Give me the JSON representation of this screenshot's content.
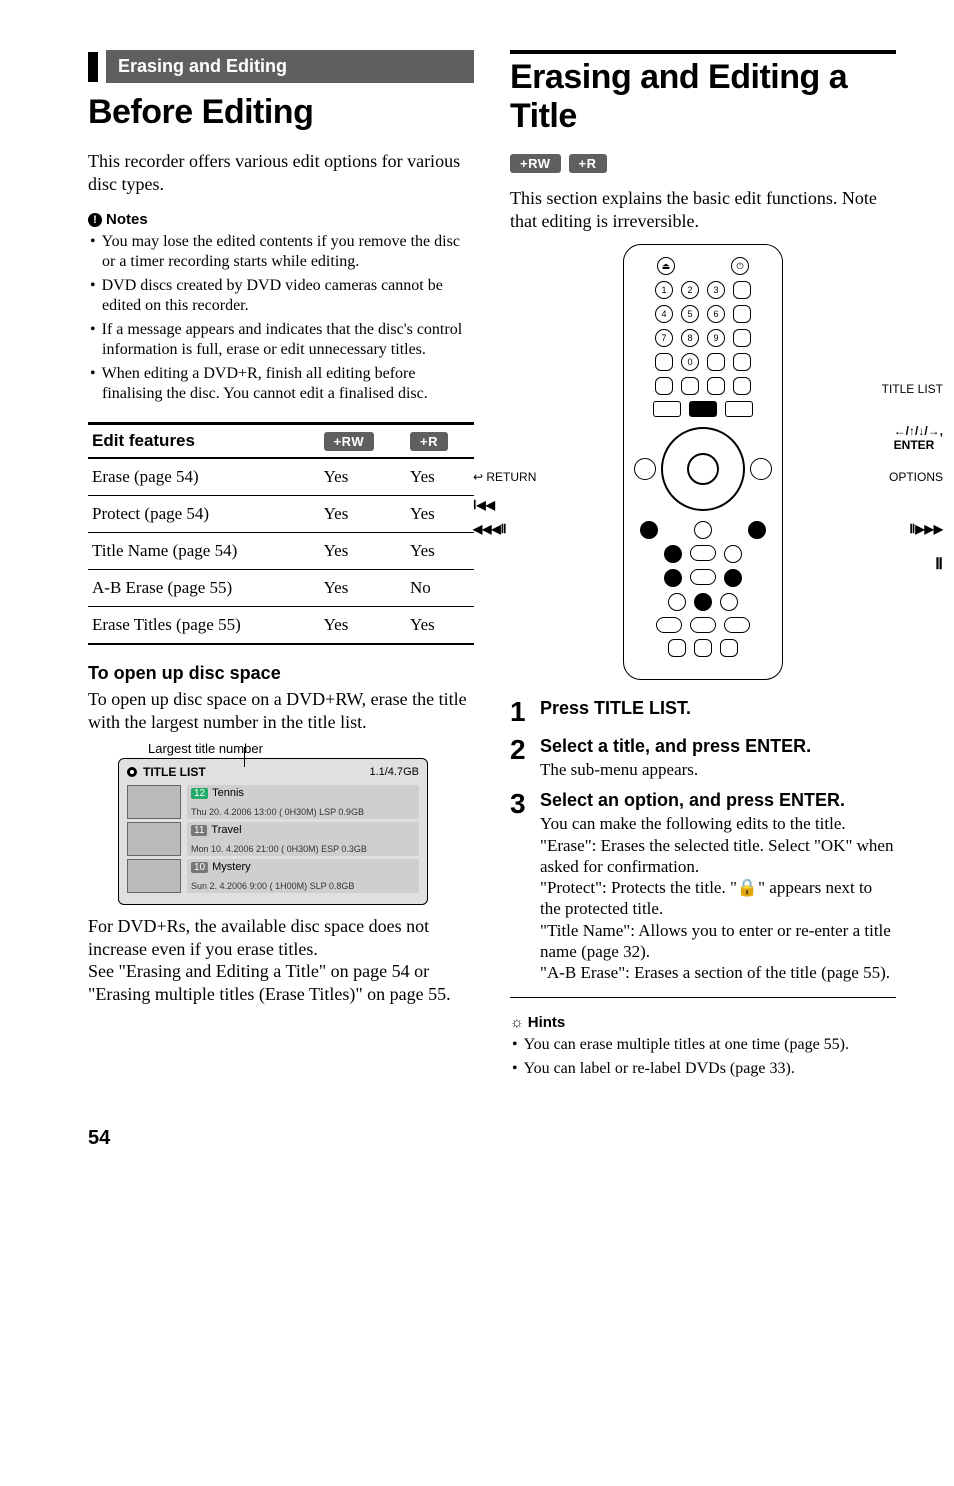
{
  "page_number": "54",
  "left": {
    "section_label": "Erasing and Editing",
    "h1": "Before Editing",
    "intro": "This recorder offers various edit options for various disc types.",
    "notes_heading": "Notes",
    "notes": [
      "You may lose the edited contents if you remove the disc or a timer recording starts while editing.",
      "DVD discs created by DVD video cameras cannot be edited on this recorder.",
      "If a message appears and indicates that the disc's control information is full, erase or edit unnecessary titles.",
      "When editing a DVD+R, finish all editing before finalising the disc. You cannot edit a finalised disc."
    ],
    "table": {
      "head_feature": "Edit features",
      "col_badges": [
        "+RW",
        "+R"
      ],
      "rows": [
        {
          "feature": "Erase (page 54)",
          "c1": "Yes",
          "c2": "Yes"
        },
        {
          "feature": "Protect (page 54)",
          "c1": "Yes",
          "c2": "Yes"
        },
        {
          "feature": "Title Name (page 54)",
          "c1": "Yes",
          "c2": "Yes"
        },
        {
          "feature": "A-B Erase (page 55)",
          "c1": "Yes",
          "c2": "No"
        },
        {
          "feature": "Erase Titles (page 55)",
          "c1": "Yes",
          "c2": "Yes"
        }
      ]
    },
    "open_up_heading": "To open up disc space",
    "open_up_body": "To open up disc space on a DVD+RW, erase the title with the largest number in the title list.",
    "caption_largest": "Largest title number",
    "title_list": {
      "label": "TITLE LIST",
      "cap": "1.1/4.7GB",
      "rows": [
        {
          "num": "12",
          "name": "Tennis",
          "meta": "Thu  20. 4.2006   13:00 (  0H30M) LSP 0.9GB"
        },
        {
          "num": "11",
          "name": "Travel",
          "meta": "Mon  10. 4.2006   21:00 (  0H30M) ESP 0.3GB"
        },
        {
          "num": "10",
          "name": "Mystery",
          "meta": "Sun    2. 4.2006     9:00 (  1H00M) SLP 0.8GB"
        }
      ]
    },
    "after_list": "For DVD+Rs, the available disc space does not increase even if you erase titles.\nSee \"Erasing and Editing a Title\" on page 54 or \"Erasing multiple titles (Erase Titles)\" on page 55."
  },
  "right": {
    "h1": "Erasing and Editing a Title",
    "badges": [
      "+RW",
      "+R"
    ],
    "intro": "This section explains the basic edit functions. Note that editing is irreversible.",
    "remote_labels": {
      "title_list": "TITLE LIST",
      "arrows_enter": "←/↑/↓/→, ENTER",
      "options": "OPTIONS",
      "return": "RETURN",
      "prev": "⏮",
      "rew_step": "◀◀◀⏸",
      "fwd_step": "⏸▶▶▶",
      "pause": "⏸"
    },
    "steps": [
      {
        "num": "1",
        "title": "Press TITLE LIST.",
        "desc": ""
      },
      {
        "num": "2",
        "title": "Select a title, and press ENTER.",
        "desc": "The sub-menu appears."
      },
      {
        "num": "3",
        "title": "Select an option, and press ENTER.",
        "desc": "You can make the following edits to the title.\n\"Erase\": Erases the selected title. Select \"OK\" when asked for confirmation.\n\"Protect\": Protects the title. \"🔒\" appears next to the protected title.\n\"Title Name\": Allows you to enter or re-enter a title name (page 32).\n\"A-B Erase\": Erases a section of the title (page 55)."
      }
    ],
    "hints_heading": "Hints",
    "hints": [
      "You can erase multiple titles at one time (page 55).",
      "You can label or re-label DVDs (page 33)."
    ]
  }
}
